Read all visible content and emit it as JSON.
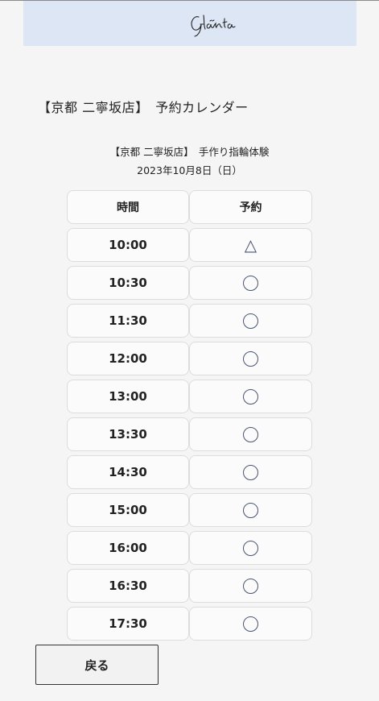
{
  "header": {
    "logo_text": "Glänta"
  },
  "page_title": "【京都 二寧坂店】　予約カレンダー",
  "subtitle": "【京都 二寧坂店】　手作り指輪体験",
  "date": "2023年10月8日（日）",
  "table": {
    "columns": [
      "時間",
      "予約"
    ],
    "rows": [
      {
        "time": "10:00",
        "status": "triangle",
        "symbol": "△"
      },
      {
        "time": "10:30",
        "status": "circle",
        "symbol": "○"
      },
      {
        "time": "11:30",
        "status": "circle",
        "symbol": "○"
      },
      {
        "time": "12:00",
        "status": "circle",
        "symbol": "○"
      },
      {
        "time": "13:00",
        "status": "circle",
        "symbol": "○"
      },
      {
        "time": "13:30",
        "status": "circle",
        "symbol": "○"
      },
      {
        "time": "14:30",
        "status": "circle",
        "symbol": "○"
      },
      {
        "time": "15:00",
        "status": "circle",
        "symbol": "○"
      },
      {
        "time": "16:00",
        "status": "circle",
        "symbol": "○"
      },
      {
        "time": "16:30",
        "status": "circle",
        "symbol": "○"
      },
      {
        "time": "17:30",
        "status": "circle",
        "symbol": "○"
      }
    ]
  },
  "back_button_label": "戻る",
  "colors": {
    "header_bg": "#dde6f5",
    "page_bg": "#f5f5f5",
    "mark": "#4a5470"
  }
}
